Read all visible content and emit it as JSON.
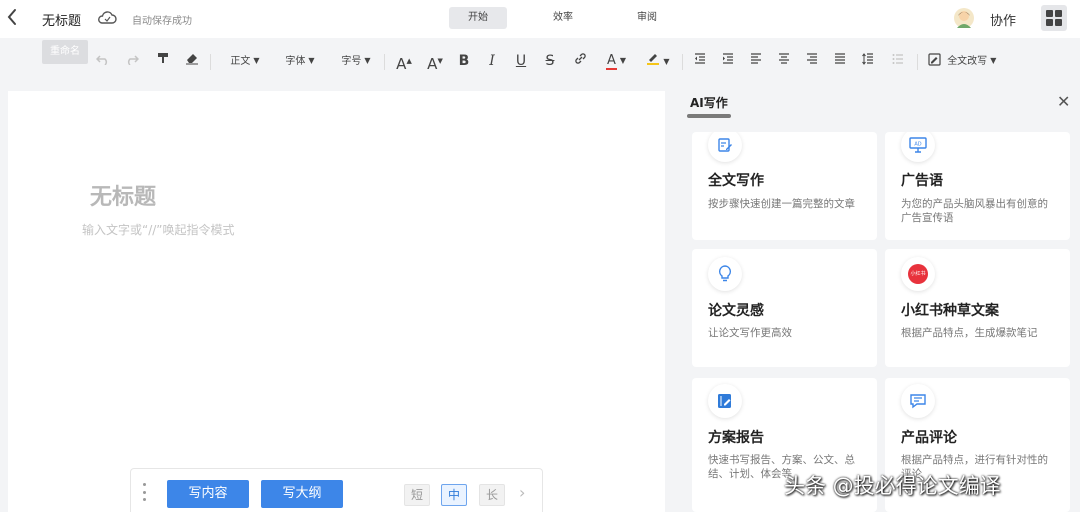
{
  "header": {
    "back_icon": "chevron-left-icon",
    "doc_title": "无标题",
    "cloud_icon": "cloud-icon",
    "autosave_status": "自动保存成功",
    "tabs": [
      {
        "label": "开始"
      },
      {
        "label": "效率"
      },
      {
        "label": "审阅"
      }
    ],
    "collab_label": "协作",
    "apps_icon": "grid-apps-icon"
  },
  "tooltip": {
    "text": "重命名"
  },
  "toolbar": {
    "paragraph_style": "正文",
    "font_family": "字体",
    "font_size": "字号",
    "grow_font": "A",
    "shrink_font": "A",
    "bold": "B",
    "italic": "I",
    "underline": "U",
    "strike": "S",
    "font_color": "A",
    "rewrite_label": "全文改写"
  },
  "editor": {
    "title_placeholder": "无标题",
    "body_placeholder": "输入文字或“//”唤起指令模式"
  },
  "writebar": {
    "write_content": "写内容",
    "write_outline": "写大纲",
    "lengths": [
      "短",
      "中",
      "长"
    ],
    "selected_length": "中"
  },
  "ai_panel": {
    "title": "AI写作",
    "cards": [
      {
        "icon": "edit-document-icon",
        "title": "全文写作",
        "desc": "按步骤快速创建一篇完整的文章"
      },
      {
        "icon": "ad-screen-icon",
        "title": "广告语",
        "desc": "为您的产品头脑风暴出有创意的广告宣传语"
      },
      {
        "icon": "lightbulb-icon",
        "title": "论文灵感",
        "desc": "让论文写作更高效"
      },
      {
        "icon": "xiaohongshu-logo-icon",
        "title": "小红书种草文案",
        "desc": "根据产品特点，生成爆款笔记",
        "icon_text": "小红书"
      },
      {
        "icon": "notebook-pen-icon",
        "title": "方案报告",
        "desc": "快速书写报告、方案、公文、总结、计划、体会等"
      },
      {
        "icon": "chat-bubble-icon",
        "title": "产品评论",
        "desc": "根据产品特点，进行有针对性的评论"
      }
    ]
  },
  "watermark": {
    "text": "头条 @投必得论文编译"
  },
  "colors": {
    "primary_button": "#3d86e8",
    "font_color_bar": "#e53935",
    "highlight_bar": "#f5c518",
    "xiaohongshu_red": "#e8323c"
  }
}
